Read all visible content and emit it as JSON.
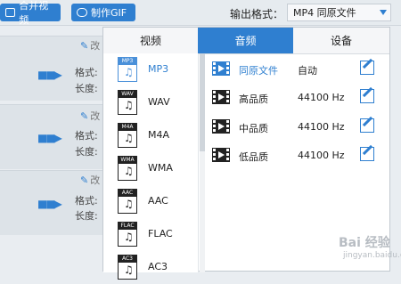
{
  "toolbar": {
    "merge_label": "合并视频",
    "gif_label": "制作GIF"
  },
  "output": {
    "label": "输出格式：",
    "selected": "MP4  同原文件"
  },
  "rows": [
    {
      "edit": "改",
      "format": "格式:",
      "length": "长度:"
    },
    {
      "edit": "改",
      "format": "格式:",
      "length": "长度:"
    },
    {
      "edit": "改",
      "format": "格式:",
      "length": "长度:"
    }
  ],
  "tabs": [
    "视频",
    "音频",
    "设备"
  ],
  "formats": [
    {
      "tag": "MP3",
      "name": "MP3"
    },
    {
      "tag": "WAV",
      "name": "WAV"
    },
    {
      "tag": "M4A",
      "name": "M4A"
    },
    {
      "tag": "WMA",
      "name": "WMA"
    },
    {
      "tag": "AAC",
      "name": "AAC"
    },
    {
      "tag": "FLAC",
      "name": "FLAC"
    },
    {
      "tag": "AC3",
      "name": "AC3"
    }
  ],
  "qualities": [
    {
      "name": "同原文件",
      "rate": "自动"
    },
    {
      "name": "高品质",
      "rate": "44100 Hz"
    },
    {
      "name": "中品质",
      "rate": "44100 Hz"
    },
    {
      "name": "低品质",
      "rate": "44100 Hz"
    }
  ],
  "colors": {
    "accent": "#2f7fd0",
    "selected": "#4a90d9",
    "panel_bg": "#ffffff",
    "app_bg": "#e9edf1"
  },
  "watermark": {
    "main": "Bai 经验",
    "sub": "jingyan.baidu.com"
  }
}
